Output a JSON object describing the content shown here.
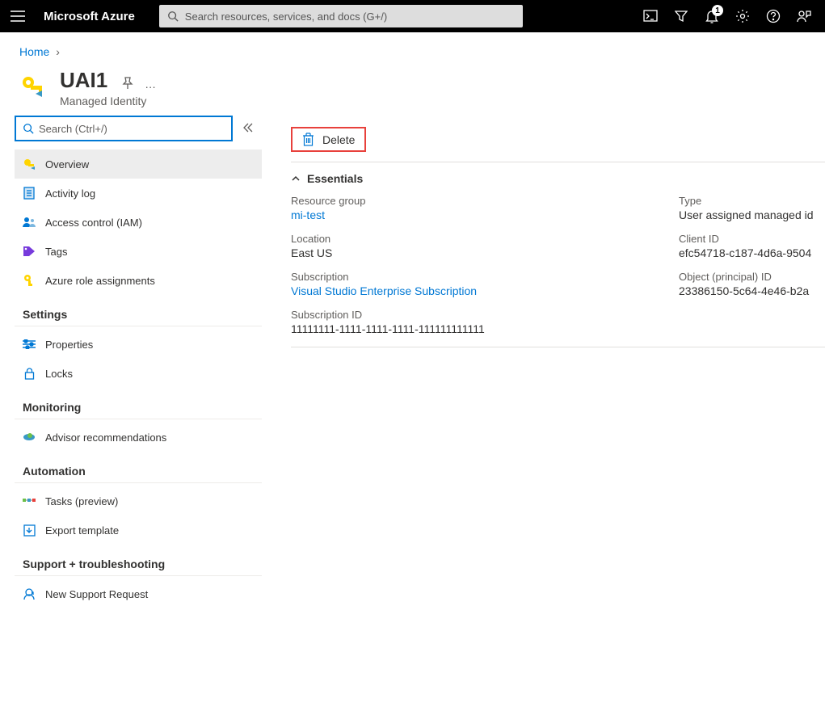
{
  "topbar": {
    "brand": "Microsoft Azure",
    "search_placeholder": "Search resources, services, and docs (G+/)",
    "notification_count": "1"
  },
  "breadcrumb": {
    "home": "Home"
  },
  "page": {
    "title": "UAI1",
    "subtitle": "Managed Identity"
  },
  "sidebar": {
    "search_placeholder": "Search (Ctrl+/)",
    "items_main": [
      {
        "label": "Overview"
      },
      {
        "label": "Activity log"
      },
      {
        "label": "Access control (IAM)"
      },
      {
        "label": "Tags"
      },
      {
        "label": "Azure role assignments"
      }
    ],
    "sect_settings": "Settings",
    "items_settings": [
      {
        "label": "Properties"
      },
      {
        "label": "Locks"
      }
    ],
    "sect_monitoring": "Monitoring",
    "items_monitoring": [
      {
        "label": "Advisor recommendations"
      }
    ],
    "sect_automation": "Automation",
    "items_automation": [
      {
        "label": "Tasks (preview)"
      },
      {
        "label": "Export template"
      }
    ],
    "sect_support": "Support + troubleshooting",
    "items_support": [
      {
        "label": "New Support Request"
      }
    ]
  },
  "toolbar": {
    "delete_label": "Delete"
  },
  "essentials": {
    "toggle_label": "Essentials",
    "resource_group_label": "Resource group",
    "resource_group_value": "mi-test",
    "location_label": "Location",
    "location_value": "East US",
    "subscription_label": "Subscription",
    "subscription_value": "Visual Studio Enterprise Subscription",
    "subscription_id_label": "Subscription ID",
    "subscription_id_value": "11111111-1111-1111-1111-111111111111",
    "type_label": "Type",
    "type_value": "User assigned managed id",
    "client_id_label": "Client ID",
    "client_id_value": "efc54718-c187-4d6a-9504",
    "object_id_label": "Object (principal) ID",
    "object_id_value": "23386150-5c64-4e46-b2a"
  }
}
